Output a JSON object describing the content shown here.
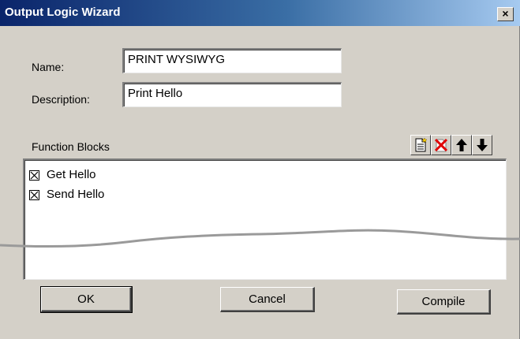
{
  "window": {
    "title": "Output Logic Wizard",
    "close_label": "×",
    "colors": {
      "title_start": "#0a246a",
      "title_end": "#a6caf0",
      "face": "#d4d0c8"
    }
  },
  "form": {
    "name_label": "Name:",
    "name_value": "PRINT WYSIWYG",
    "description_label": "Description:",
    "description_value": "Print Hello"
  },
  "function_blocks": {
    "label": "Function Blocks",
    "toolbar": [
      {
        "name": "new-icon"
      },
      {
        "name": "delete-icon"
      },
      {
        "name": "arrow-up-icon"
      },
      {
        "name": "arrow-down-icon"
      }
    ],
    "items": [
      {
        "label": "Get Hello",
        "checked": true
      },
      {
        "label": "Send Hello",
        "checked": true
      }
    ]
  },
  "buttons": {
    "ok": "OK",
    "cancel": "Cancel",
    "compile": "Compile"
  }
}
